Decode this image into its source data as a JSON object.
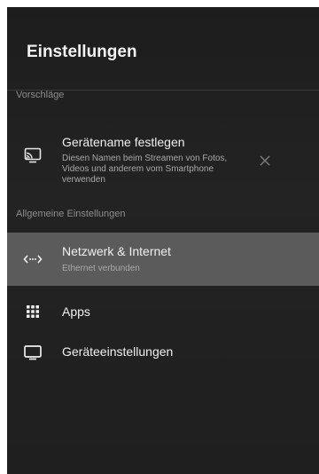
{
  "header": {
    "title": "Einstellungen"
  },
  "suggestions": {
    "section_label": "Vorschläge",
    "item": {
      "title": "Gerätename festlegen",
      "description_lines": [
        "Diesen Namen beim Streamen von Fotos,",
        "Videos und anderem vom Smartphone",
        "verwenden"
      ],
      "icon": "cast-icon",
      "dismiss_icon": "close-icon"
    }
  },
  "general": {
    "section_label": "Allgemeine Einstellungen",
    "items": [
      {
        "title": "Netzwerk & Internet",
        "subtitle": "Ethernet verbunden",
        "icon": "network-icon",
        "selected": true
      },
      {
        "title": "Apps",
        "icon": "apps-grid-icon",
        "selected": false
      },
      {
        "title": "Geräteeinstellungen",
        "icon": "tv-icon",
        "selected": false
      }
    ]
  },
  "colors": {
    "background": "#1f1f1f",
    "selected_row": "#5b5b5b",
    "section_text": "#8d8d8d",
    "primary_text": "#f0f0f0"
  }
}
